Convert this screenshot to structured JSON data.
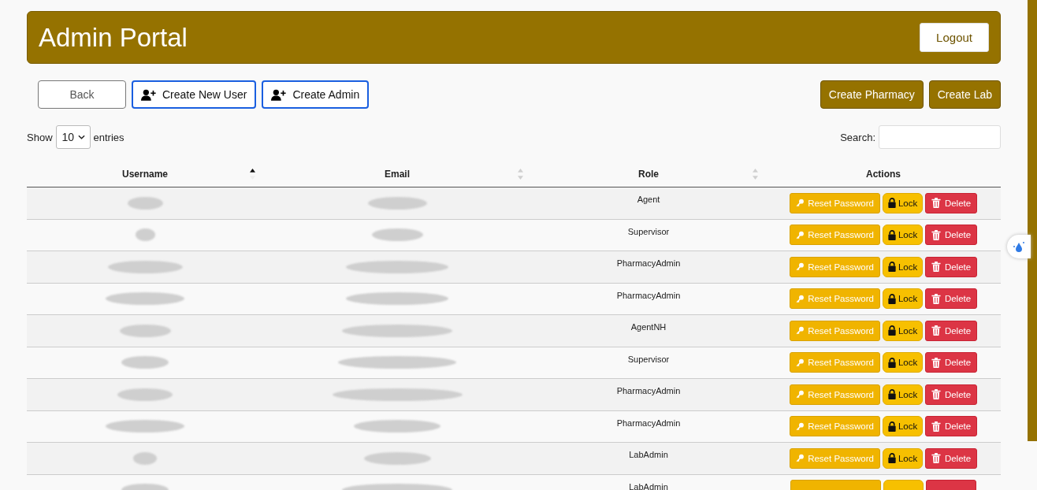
{
  "header": {
    "title": "Admin Portal",
    "logout": "Logout"
  },
  "toolbar": {
    "left": [
      {
        "label": "Back",
        "kind": "plain"
      },
      {
        "label": "Create New User",
        "kind": "user-add"
      },
      {
        "label": "Create Admin",
        "kind": "user-add"
      }
    ],
    "right": [
      {
        "label": "Create Pharmacy"
      },
      {
        "label": "Create Lab"
      }
    ]
  },
  "length": {
    "show": "Show",
    "value": "10",
    "entries": "entries"
  },
  "search": {
    "label": "Search:"
  },
  "table": {
    "columns": [
      {
        "label": "Username",
        "sortable": true,
        "sorted": true
      },
      {
        "label": "Email",
        "sortable": true,
        "sorted": false
      },
      {
        "label": "Role",
        "sortable": true,
        "sorted": false
      },
      {
        "label": "Actions",
        "sortable": false
      }
    ],
    "rows": [
      {
        "role": "Agent",
        "actions": [
          {
            "kind": "reset",
            "label": "Reset Password"
          },
          {
            "kind": "lock",
            "label": "Lock"
          },
          {
            "kind": "delete",
            "label": "Delete"
          }
        ]
      },
      {
        "role": "Supervisor",
        "actions": [
          {
            "kind": "reset",
            "label": "Reset Password"
          },
          {
            "kind": "lock",
            "label": "Lock"
          },
          {
            "kind": "delete",
            "label": "Delete"
          }
        ]
      },
      {
        "role": "PharmacyAdmin",
        "actions": [
          {
            "kind": "reset",
            "label": "Reset Password"
          },
          {
            "kind": "lock",
            "label": "Lock"
          },
          {
            "kind": "delete",
            "label": "Delete"
          }
        ]
      },
      {
        "role": "PharmacyAdmin",
        "actions": [
          {
            "kind": "reset",
            "label": "Reset Password"
          },
          {
            "kind": "lock",
            "label": "Lock"
          },
          {
            "kind": "delete",
            "label": "Delete"
          }
        ]
      },
      {
        "role": "AgentNH",
        "actions": [
          {
            "kind": "reset",
            "label": "Reset Password"
          },
          {
            "kind": "lock",
            "label": "Lock"
          },
          {
            "kind": "delete",
            "label": "Delete"
          }
        ]
      },
      {
        "role": "Supervisor",
        "actions": [
          {
            "kind": "reset",
            "label": "Reset Password"
          },
          {
            "kind": "lock",
            "label": "Lock"
          },
          {
            "kind": "delete",
            "label": "Delete"
          }
        ]
      },
      {
        "role": "PharmacyAdmin",
        "actions": [
          {
            "kind": "reset",
            "label": "Reset Password"
          },
          {
            "kind": "lock",
            "label": "Lock"
          },
          {
            "kind": "delete",
            "label": "Delete"
          }
        ]
      },
      {
        "role": "PharmacyAdmin",
        "actions": [
          {
            "kind": "reset",
            "label": "Reset Password"
          },
          {
            "kind": "lock",
            "label": "Lock"
          },
          {
            "kind": "delete",
            "label": "Delete"
          }
        ]
      },
      {
        "role": "LabAdmin",
        "actions": [
          {
            "kind": "reset",
            "label": "Reset Password"
          },
          {
            "kind": "lock",
            "label": "Lock"
          },
          {
            "kind": "delete",
            "label": "Delete"
          }
        ]
      },
      {
        "role": "LabAdmin",
        "actions": [
          {
            "kind": "reset"
          },
          {
            "kind": "lock"
          },
          {
            "kind": "delete"
          }
        ]
      }
    ]
  }
}
